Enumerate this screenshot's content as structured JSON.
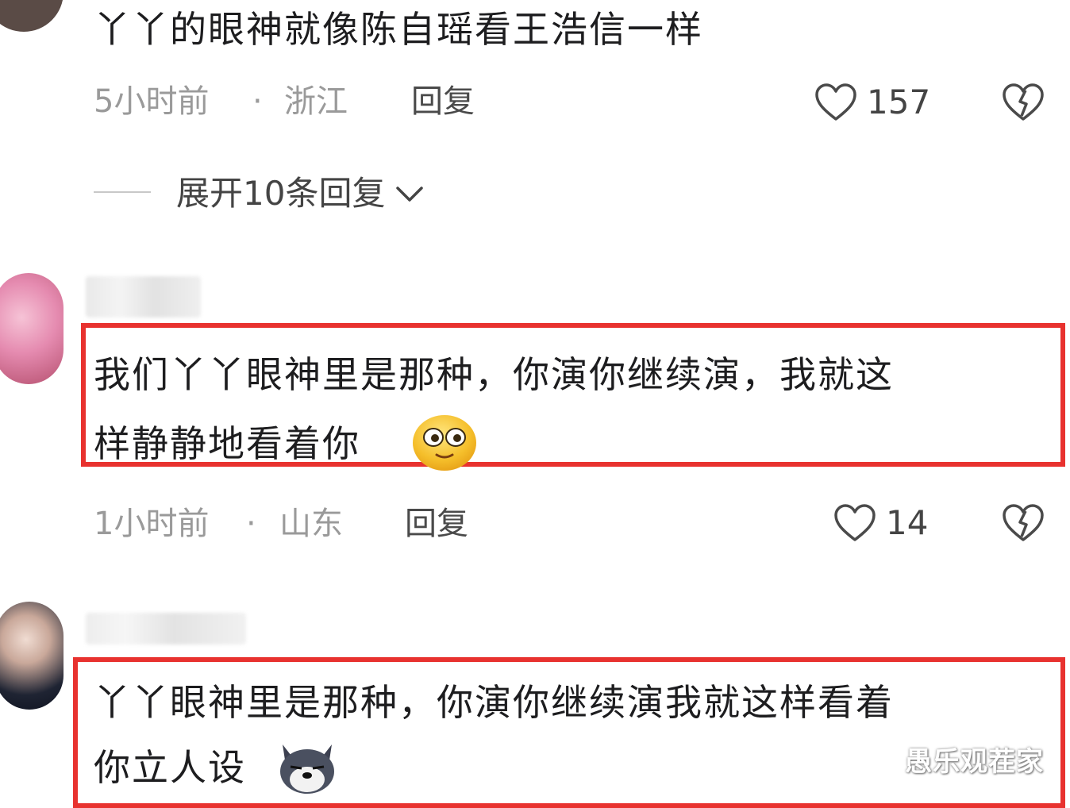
{
  "comment1": {
    "text": "丫丫的眼神就像陈自瑶看王浩信一样",
    "time": "5小时前",
    "dot": "·",
    "location": "浙江",
    "reply_label": "回复",
    "like_count": "157",
    "expand_replies": "展开10条回复"
  },
  "comment2": {
    "line1": "我们丫丫眼神里是那种，你演你继续演，我就这",
    "line2": "样静静地看着你",
    "emoji": "face-emoji",
    "time": "1小时前",
    "dot": "·",
    "location": "山东",
    "reply_label": "回复",
    "like_count": "14"
  },
  "comment3": {
    "line1": "丫丫眼神里是那种，你演你继续演我就这样看着",
    "line2": "你立人设",
    "emoji": "dog-emoji"
  },
  "watermark": "愚乐观茬家",
  "colors": {
    "highlight": "#e8322f",
    "meta": "#9a9a9a",
    "text": "#1d1d1f"
  }
}
